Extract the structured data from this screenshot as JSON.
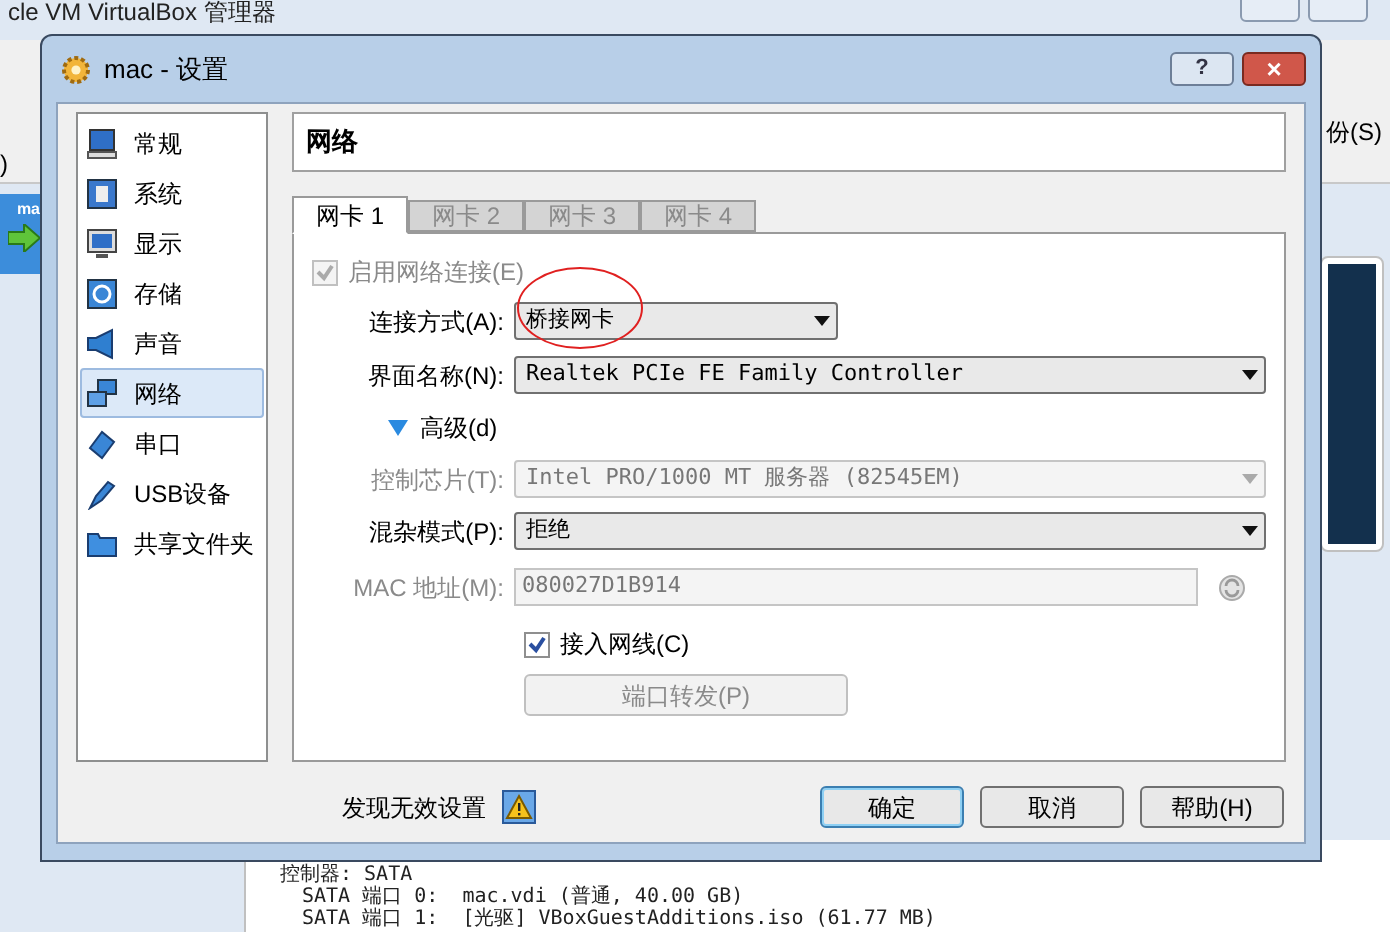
{
  "background_window": {
    "title": "cle VM VirtualBox 管理器",
    "toolbar_left_text": ")",
    "toolbar_right_text": "份(S)",
    "vm_item_label": "ma",
    "details_lines": [
      "控制器: SATA",
      "SATA 端口 0:  mac.vdi (普通, 40.00 GB)",
      "SATA 端口 1:  [光驱] VBoxGuestAdditions.iso (61.77 MB)"
    ]
  },
  "dialog": {
    "title": "mac - 设置",
    "help_button": "?",
    "close_button": "×"
  },
  "sidebar": {
    "items": [
      {
        "label": "常规",
        "selected": false
      },
      {
        "label": "系统",
        "selected": false
      },
      {
        "label": "显示",
        "selected": false
      },
      {
        "label": "存储",
        "selected": false
      },
      {
        "label": "声音",
        "selected": false
      },
      {
        "label": "网络",
        "selected": true
      },
      {
        "label": "串口",
        "selected": false
      },
      {
        "label": "USB设备",
        "selected": false
      },
      {
        "label": "共享文件夹",
        "selected": false
      }
    ]
  },
  "page_title": "网络",
  "tabs": [
    {
      "label": "网卡 1",
      "selected": true
    },
    {
      "label": "网卡 2",
      "selected": false
    },
    {
      "label": "网卡 3",
      "selected": false
    },
    {
      "label": "网卡 4",
      "selected": false
    }
  ],
  "form": {
    "enable_adapter": {
      "label": "启用网络连接(E)",
      "checked": true,
      "disabled": true
    },
    "attached_to": {
      "label": "连接方式(A):",
      "value": "桥接网卡",
      "annotated": true
    },
    "interface_name": {
      "label": "界面名称(N):",
      "value": "Realtek PCIe FE Family Controller"
    },
    "advanced": {
      "label": "高级(d)",
      "expanded": true
    },
    "adapter_type": {
      "label": "控制芯片(T):",
      "value": "Intel PRO/1000 MT 服务器 (82545EM)",
      "disabled": true
    },
    "promiscuous_mode": {
      "label": "混杂模式(P):",
      "value": "拒绝"
    },
    "mac_address": {
      "label": "MAC 地址(M):",
      "value": "080027D1B914",
      "disabled": true
    },
    "cable_connected": {
      "label": "接入网线(C)",
      "checked": true
    },
    "port_forwarding": {
      "label": "端口转发(P)",
      "disabled": true
    }
  },
  "footer": {
    "warning_text": "发现无效设置",
    "buttons": [
      {
        "label": "确定",
        "focused": true
      },
      {
        "label": "取消",
        "focused": false
      },
      {
        "label": "帮助(H)",
        "focused": false
      }
    ]
  }
}
